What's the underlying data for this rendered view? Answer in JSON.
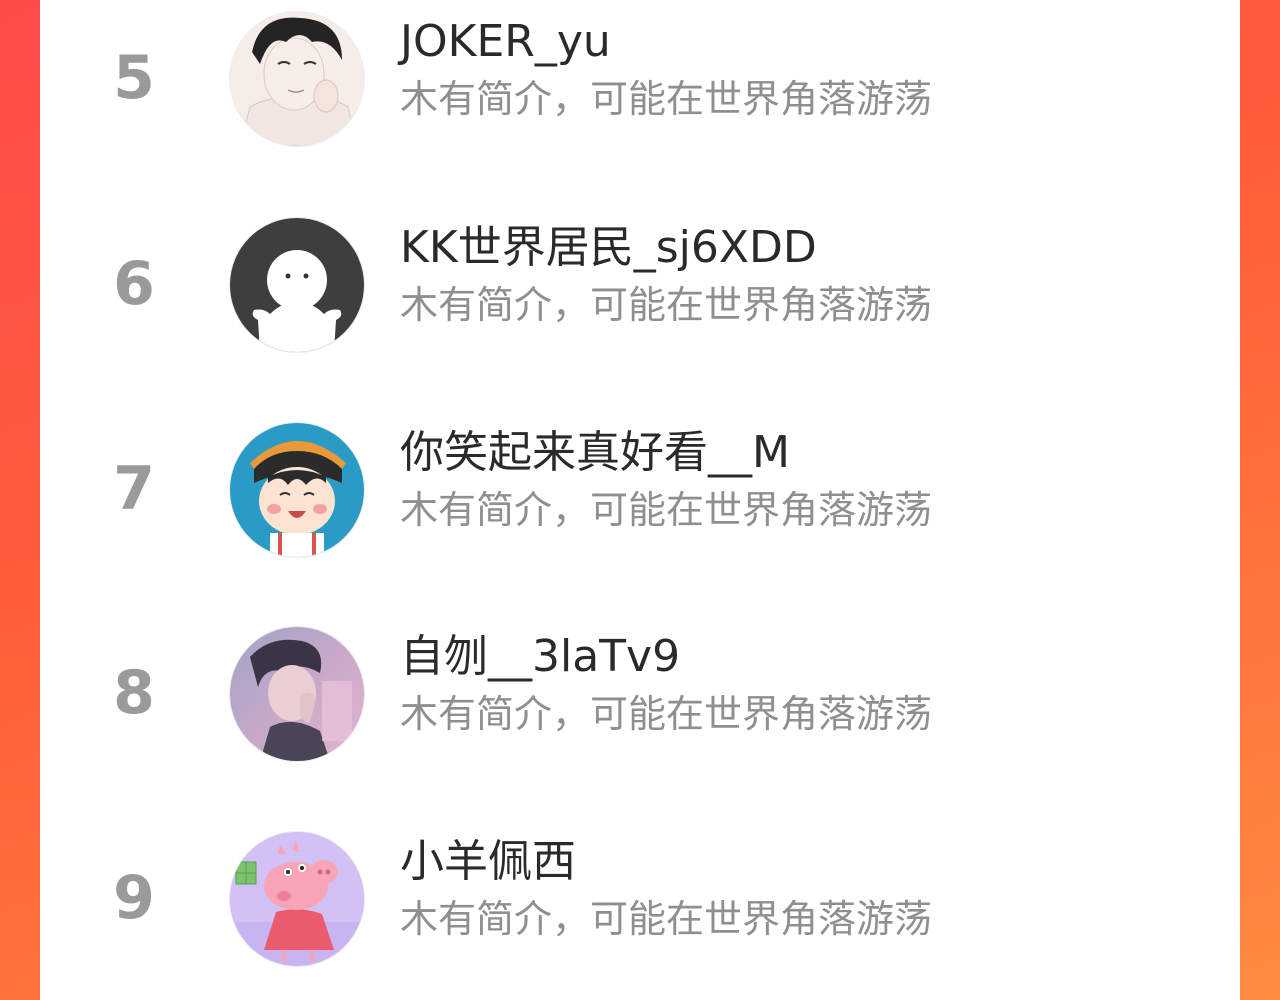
{
  "ranking": {
    "items": [
      {
        "rank": "5",
        "name": "JOKER_yu",
        "bio": "木有简介，可能在世界角落游荡",
        "avatar": "anime-boy-avatar"
      },
      {
        "rank": "6",
        "name": "KK世界居民_sj6XDD",
        "bio": "木有简介，可能在世界角落游荡",
        "avatar": "default-white-figure-avatar"
      },
      {
        "rank": "7",
        "name": "你笑起来真好看__M",
        "bio": "木有简介，可能在世界角落游荡",
        "avatar": "maruko-cartoon-avatar"
      },
      {
        "rank": "8",
        "name": "自刎__3laTv9",
        "bio": "木有简介，可能在世界角落游荡",
        "avatar": "photo-portrait-avatar"
      },
      {
        "rank": "9",
        "name": "小羊佩西",
        "bio": "木有简介，可能在世界角落游荡",
        "avatar": "peppa-pig-avatar"
      }
    ]
  },
  "colors": {
    "background_gradient_start": "#ff4a4a",
    "background_gradient_end": "#ff8c40",
    "card": "#ffffff",
    "rank_text": "#9a9a9a",
    "name_text": "#2a2a2a",
    "bio_text": "#8f8f8f"
  }
}
